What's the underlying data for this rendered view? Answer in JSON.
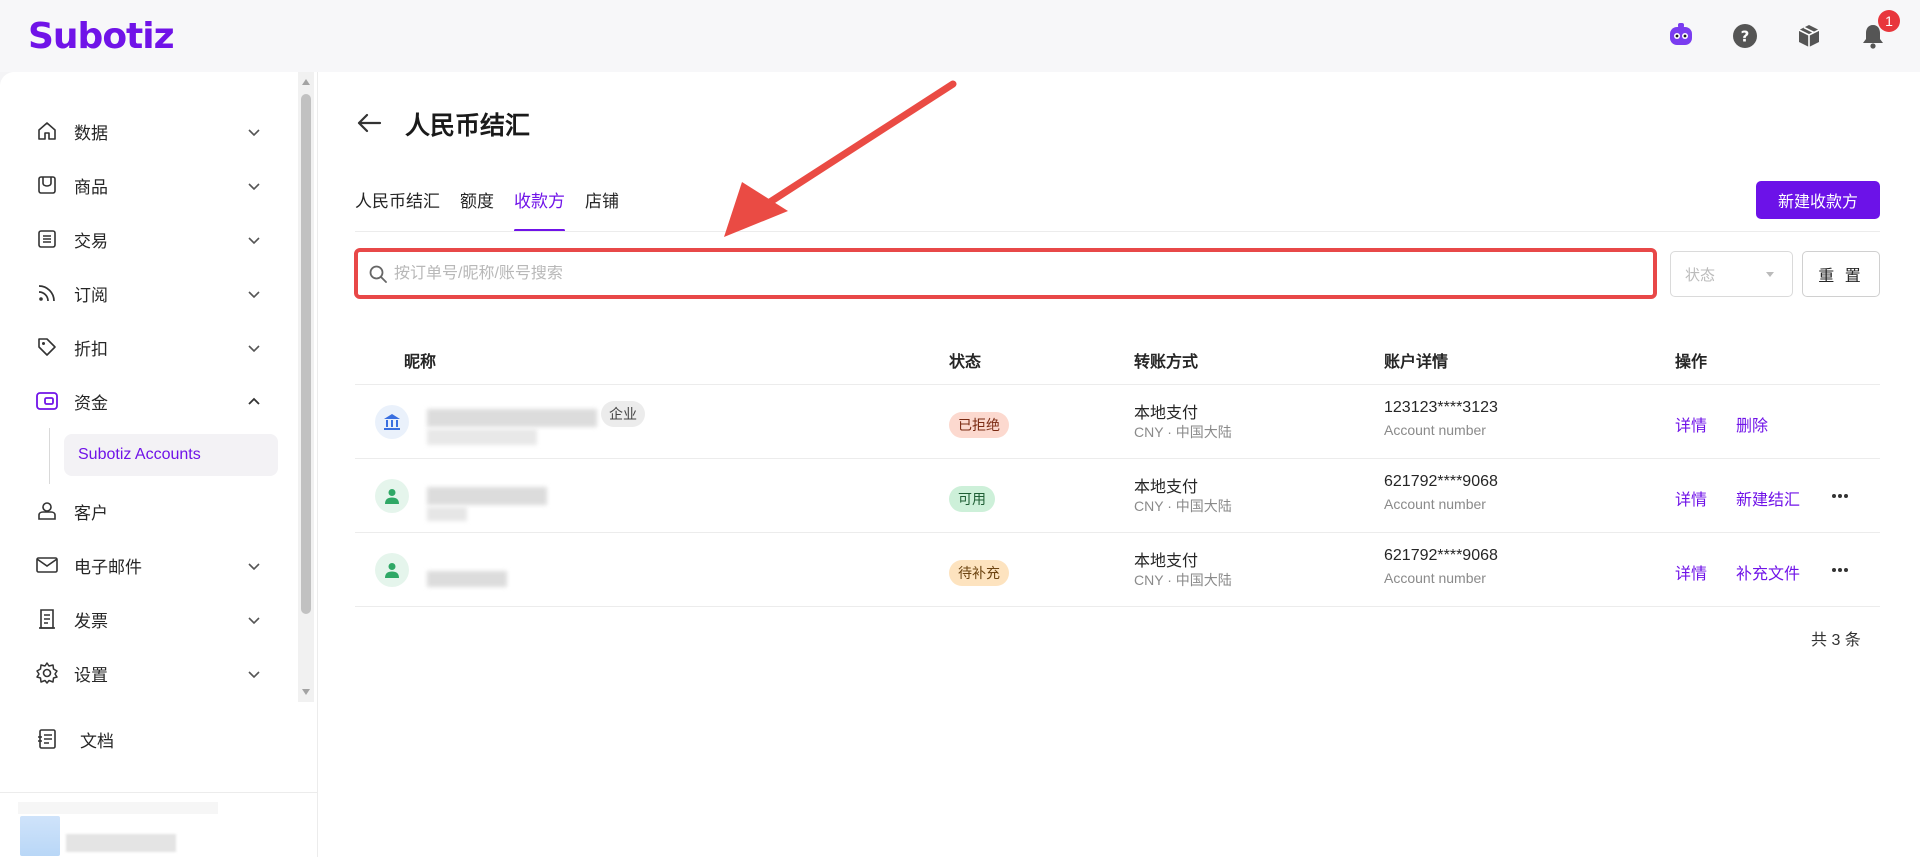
{
  "app": {
    "logo": "Subotiz",
    "notification_count": "1"
  },
  "sidebar": {
    "items": [
      {
        "label": "数据",
        "icon": "home-icon"
      },
      {
        "label": "商品",
        "icon": "store-icon"
      },
      {
        "label": "交易",
        "icon": "list-icon"
      },
      {
        "label": "订阅",
        "icon": "rss-icon"
      },
      {
        "label": "折扣",
        "icon": "tag-icon"
      },
      {
        "label": "资金",
        "icon": "wallet-icon"
      },
      {
        "label": "客户",
        "icon": "user-icon"
      },
      {
        "label": "电子邮件",
        "icon": "mail-icon"
      },
      {
        "label": "发票",
        "icon": "receipt-icon"
      },
      {
        "label": "设置",
        "icon": "gear-icon"
      }
    ],
    "sub_item": "Subotiz Accounts",
    "docs": "文档"
  },
  "page": {
    "title": "人民币结汇",
    "tabs": [
      "人民币结汇",
      "额度",
      "收款方",
      "店铺"
    ],
    "active_tab": "收款方",
    "new_button": "新建收款方",
    "search_placeholder": "按订单号/昵称/账号搜索",
    "status_placeholder": "状态",
    "reset_button": "重 置"
  },
  "table": {
    "headers": {
      "nickname": "昵称",
      "status": "状态",
      "method": "转账方式",
      "account": "账户详情",
      "actions": "操作"
    },
    "rows": [
      {
        "type": "bank",
        "tag": "企业",
        "status": "已拒绝",
        "status_kind": "rejected",
        "method": "本地支付",
        "method_sub": "CNY · 中国大陆",
        "account": "123123****3123",
        "account_sub": "Account number",
        "action1": "详情",
        "action2": "删除"
      },
      {
        "type": "person",
        "status": "可用",
        "status_kind": "available",
        "method": "本地支付",
        "method_sub": "CNY · 中国大陆",
        "account": "621792****9068",
        "account_sub": "Account number",
        "action1": "详情",
        "action2": "新建结汇"
      },
      {
        "type": "person",
        "status": "待补充",
        "status_kind": "pending",
        "method": "本地支付",
        "method_sub": "CNY · 中国大陆",
        "account": "621792****9068",
        "account_sub": "Account number",
        "action1": "详情",
        "action2": "补充文件"
      }
    ],
    "total": "共 3 条"
  },
  "colors": {
    "accent": "#7013e8",
    "highlight": "#e84848"
  }
}
